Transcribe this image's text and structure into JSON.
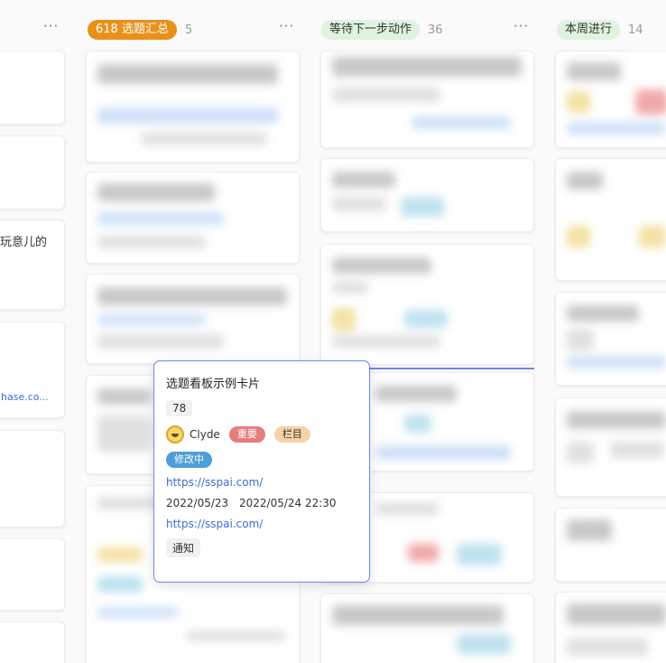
{
  "columns": [
    {
      "title": "618 选题汇总",
      "count": "5",
      "pill_bg": "#e8911a",
      "pill_color": "#ffffff"
    },
    {
      "title": "等待下一步动作",
      "count": "36",
      "pill_bg": "#dff3de",
      "pill_color": "#333333"
    },
    {
      "title": "本周进行",
      "count": "14",
      "pill_bg": "#dff3de",
      "pill_color": "#333333"
    }
  ],
  "more_label": "···",
  "left_column": {
    "fragment_text": "玩意儿的",
    "fragment_link": "hase.co..."
  },
  "popup": {
    "title": "选题看板示例卡片",
    "number": "78",
    "user": "Clyde",
    "tags": [
      {
        "label": "重要",
        "bg": "#e67c7c",
        "color": "#ffffff"
      },
      {
        "label": "栏目",
        "bg": "#f6d3a7",
        "color": "#333333"
      }
    ],
    "status": {
      "label": "修改中",
      "bg": "#4f9fd6",
      "color": "#ffffff"
    },
    "link1": "https://sspai.com/",
    "date_start": "2022/05/23",
    "date_end": "2022/05/24  22:30",
    "link2": "https://sspai.com/",
    "notice": "通知"
  }
}
